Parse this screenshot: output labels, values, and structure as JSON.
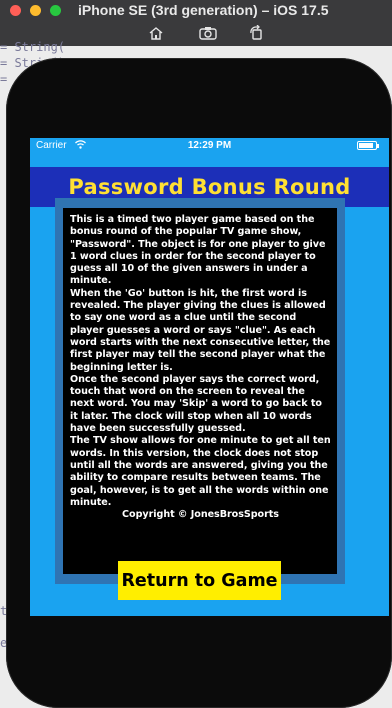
{
  "window": {
    "title": "iPhone SE (3rd generation) – iOS 17.5",
    "toolbar_icons": [
      "home-icon",
      "screenshot-icon",
      "rotate-icon"
    ]
  },
  "background_code": {
    "lines": [
      "= String(",
      "= Strin()",
      "= "
    ],
    "fragments": [
      "t",
      "e"
    ]
  },
  "status_bar": {
    "carrier": "Carrier",
    "time": "12:29 PM",
    "battery_level": 0.9
  },
  "header": {
    "title": "Password Bonus Round"
  },
  "instructions": {
    "paragraphs": [
      "This is a timed two player game based on the bonus round of the popular TV game show, \"Password\".  The object is for one player to give 1 word clues in order for the second player to guess all 10 of the given answers in under a minute.",
      "When the 'Go' button is hit, the first word is revealed.  The player giving the clues is allowed to say one word as a clue until the second player guesses a word or says \"clue\".  As each word starts with the next consecutive letter, the first player may tell the second player what the beginning letter is.",
      "Once the second player says the correct word, touch that word on the screen to reveal the next word. You may 'Skip' a word to go back to it later.  The clock will stop when all 10 words have been successfully guessed.",
      "The TV show allows for one minute to get all ten words.  In this version, the clock does not stop until all the words are answered, giving you the ability to compare results between teams. The goal, however, is to get all the words within one minute."
    ],
    "copyright": "Copyright © JonesBrosSports"
  },
  "return_button": {
    "label": "Return to Game"
  },
  "colors": {
    "screen_bg": "#1aa3f0",
    "banner_bg": "#1c2fb8",
    "banner_text": "#ffe033",
    "panel_border": "#2f74b3",
    "button_bg": "#ffee00"
  }
}
